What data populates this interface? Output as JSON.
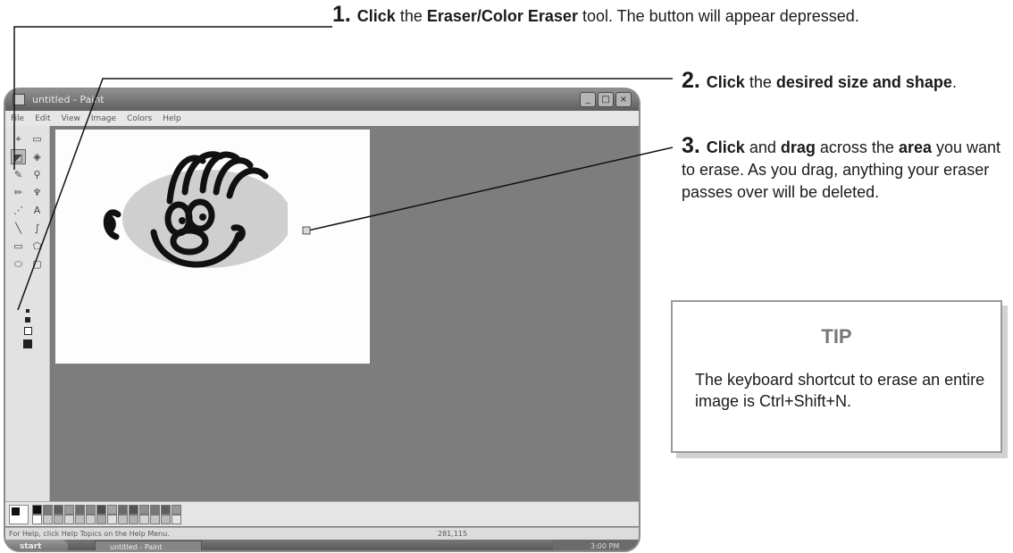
{
  "steps": [
    {
      "number": "1.",
      "parts": [
        [
          "Click",
          true
        ],
        [
          " the ",
          false
        ],
        [
          "Eraser/Color Eraser",
          true
        ],
        [
          " tool. The button will appear depressed.",
          false
        ]
      ]
    },
    {
      "number": "2.",
      "parts": [
        [
          "Click",
          true
        ],
        [
          " the ",
          false
        ],
        [
          "desired size and shape",
          true
        ],
        [
          ".",
          false
        ]
      ]
    },
    {
      "number": "3.",
      "parts": [
        [
          "Click",
          true
        ],
        [
          " and ",
          false
        ],
        [
          "drag",
          true
        ],
        [
          " across the ",
          false
        ],
        [
          "area",
          true
        ],
        [
          " you want to erase. As you drag, anything your eraser passes over will be deleted.",
          false
        ]
      ]
    }
  ],
  "tip": {
    "title": "TIP",
    "text": "The keyboard shortcut to erase an entire image is Ctrl+Shift+N."
  },
  "screenshot": {
    "window_title": "untitled - Paint",
    "window_buttons": [
      "_",
      "□",
      "×"
    ],
    "menu": [
      "File",
      "Edit",
      "View",
      "Image",
      "Colors",
      "Help"
    ],
    "tools": [
      "select-free",
      "select-rect",
      "eraser",
      "fill",
      "picker",
      "magnifier",
      "pencil",
      "brush",
      "airbrush",
      "text",
      "line",
      "curve",
      "rectangle",
      "polygon",
      "ellipse",
      "rounded-rectangle"
    ],
    "tool_glyphs": [
      "⌖",
      "▭",
      "◩",
      "◈",
      "✎",
      "⚲",
      "✏",
      "♆",
      "⋰",
      "A",
      "╲",
      "∫",
      "▭",
      "⬠",
      "⬭",
      "▢"
    ],
    "active_tool": "eraser",
    "status_text": "For Help, click Help Topics on the Help Menu.",
    "coords": "281,115",
    "start_label": "start",
    "task_label": "untitled - Paint",
    "clock": "3:00 PM",
    "palette_colors": [
      "#111111",
      "#7a7a7a",
      "#5c5c5c",
      "#9a9a9a",
      "#6d6d6d",
      "#8a8a8a",
      "#4d4d4d",
      "#a5a5a5",
      "#6a6a6a",
      "#525252",
      "#8f8f8f",
      "#777777",
      "#5f5f5f",
      "#999999",
      "#ffffff",
      "#c8c8c8",
      "#b5b5b5",
      "#d8d8d8",
      "#bdbdbd",
      "#cfcfcf",
      "#aaaaaa",
      "#e0e0e0",
      "#c2c2c2",
      "#b0b0b0",
      "#d5d5d5",
      "#c5c5c5",
      "#bababa",
      "#e5e5e5"
    ]
  }
}
